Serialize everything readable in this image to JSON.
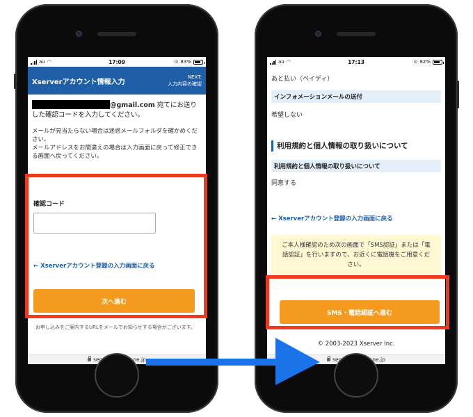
{
  "left_phone": {
    "status": {
      "carrier": "au",
      "time": "17:09",
      "battery": "83%"
    },
    "header": {
      "title": "Xserverアカウント情報入力",
      "next_line1": "NEXT:",
      "next_line2": "入力内容の確認"
    },
    "email_domain": "@gmail.com",
    "email_text": " 宛てにお送りした確認コードを入力してください。",
    "note_line1": "メールが見当たらない場合は迷惑メールフォルダを確かめください。",
    "note_line2": "メールアドレスをお間違えの場合は入力画面に戻って修正できる画面へ戻ってください。",
    "code_label": "確認コード",
    "code_value": "",
    "back_link": "← Xserverアカウント登録の入力画面に戻る",
    "next_button": "次へ進む",
    "footnote": "お申し込みをご案内するURLをメールでお知らせする場合がございます。",
    "url": "secure.xserver.ne.jp"
  },
  "right_phone": {
    "status": {
      "carrier": "au",
      "time": "17:13",
      "battery": "82%"
    },
    "payment_value": "あと払い（ペイディ）",
    "info_mail_label": "インフォメーションメールの送付",
    "info_mail_value": "希望しない",
    "section_title": "利用規約と個人情報の取り扱いについて",
    "terms_label": "利用規約と個人情報の取り扱いについて",
    "terms_value": "同意する",
    "back_link": "← Xserverアカウント登録の入力画面に戻る",
    "notice_text": "ご本人様確認のため次の画面で「SMS認証」または「電話認証」を行いますので、お近くに電話機をご用意ください。",
    "sms_button": "SMS・電話認証へ進む",
    "copyright": "© 2003-2023 Xserver Inc.",
    "url": "secure.xserver.ne.jp"
  },
  "colors": {
    "header_blue": "#1e5fa8",
    "button_orange": "#f39a1f",
    "highlight_red": "#ef3a22",
    "arrow_blue": "#1a73e8"
  }
}
